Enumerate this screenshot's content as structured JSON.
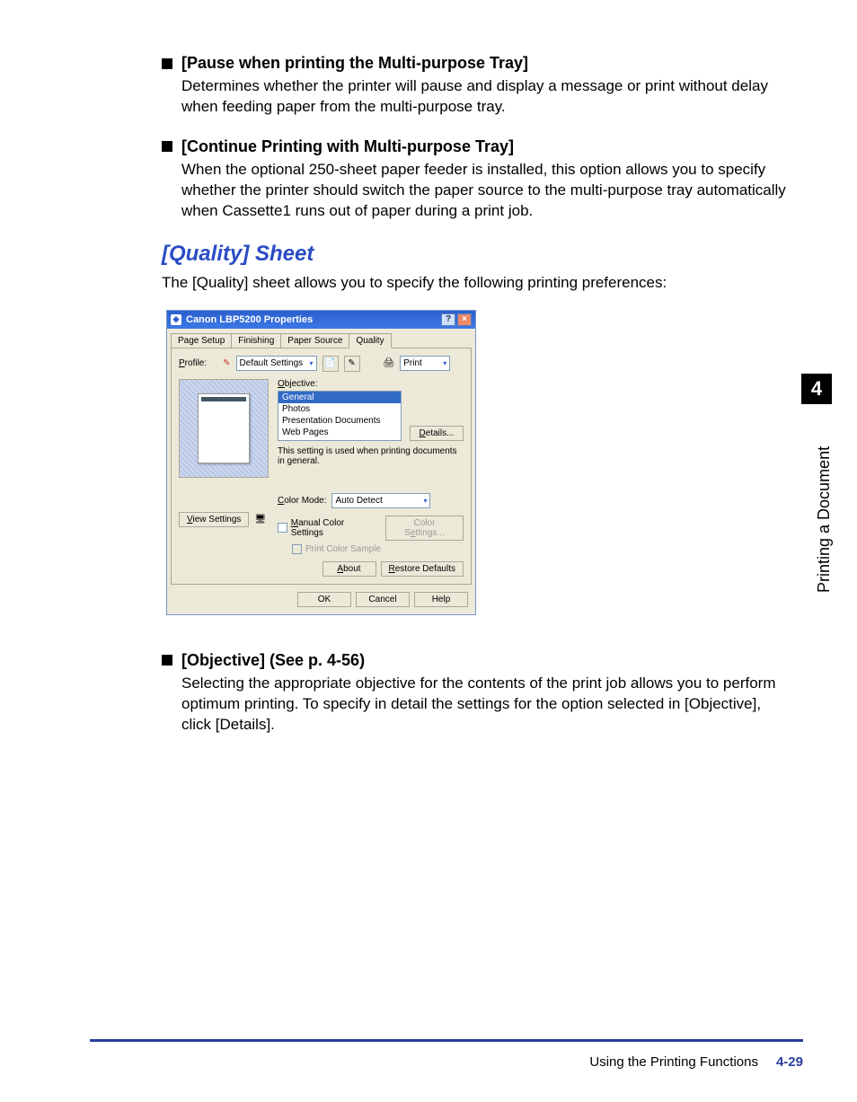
{
  "items": {
    "pause": {
      "title": "[Pause when printing the Multi-purpose Tray]",
      "body": "Determines whether the printer will pause and display a message or print without delay when feeding paper from the multi-purpose tray."
    },
    "continue": {
      "title": "[Continue Printing with Multi-purpose Tray]",
      "body": "When the optional 250-sheet paper feeder is installed, this option allows you to specify whether the printer should switch the paper source to the multi-purpose tray automatically when Cassette1 runs out of paper during a print job."
    },
    "objective": {
      "title": "[Objective] (See p. 4-56)",
      "body": "Selecting the appropriate objective for the contents of the print job allows you to perform optimum printing. To specify in detail the settings for the option selected in [Objective], click [Details]."
    }
  },
  "section": {
    "heading": "[Quality] Sheet",
    "intro": "The [Quality] sheet allows you to specify the following printing preferences:"
  },
  "dialog": {
    "title": "Canon LBP5200 Properties",
    "help": "?",
    "close": "×",
    "tabs": {
      "page_setup": "Page Setup",
      "finishing": "Finishing",
      "paper_source": "Paper Source",
      "quality": "Quality"
    },
    "profile_label": "Profile:",
    "profile_value": "Default Settings",
    "print_label": "Print",
    "objective_label": "Objective:",
    "objective_items": {
      "general": "General",
      "photos": "Photos",
      "presentation": "Presentation Documents",
      "web": "Web Pages"
    },
    "details_btn": "Details...",
    "hint_text": "This setting is used when printing documents in general.",
    "color_mode_label": "Color Mode:",
    "color_mode_value": "Auto Detect",
    "manual_color": "Manual Color Settings",
    "color_settings_btn": "Color Settings...",
    "print_sample": "Print Color Sample",
    "view_settings": "View Settings",
    "about": "About",
    "restore": "Restore Defaults",
    "ok": "OK",
    "cancel": "Cancel",
    "help_btn": "Help"
  },
  "side": {
    "chapter": "4",
    "label": "Printing a Document"
  },
  "footer": {
    "section": "Using the Printing Functions",
    "page": "4-29"
  }
}
